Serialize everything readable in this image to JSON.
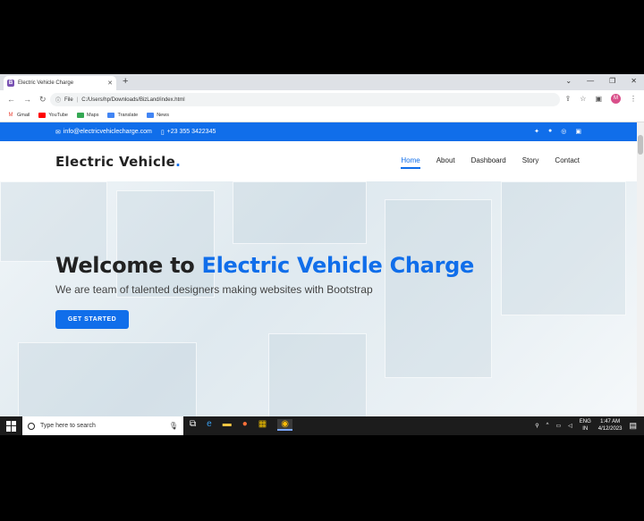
{
  "browser": {
    "tab_title": "Electric Vehicle Charge",
    "tab_favicon": "B",
    "url_prefix": "File",
    "url": "C:/Users/hp/Downloads/BizLand/index.html",
    "profile_initial": "M",
    "bookmarks": [
      {
        "label": "Gmail",
        "icon": "gmail-icon",
        "color": "#ea4335"
      },
      {
        "label": "YouTube",
        "icon": "youtube-icon",
        "color": "#ff0000"
      },
      {
        "label": "Maps",
        "icon": "maps-icon",
        "color": "#34a853"
      },
      {
        "label": "Translate",
        "icon": "translate-icon",
        "color": "#4285f4"
      },
      {
        "label": "News",
        "icon": "news-icon",
        "color": "#4285f4"
      }
    ]
  },
  "site": {
    "email": "info@electricvehiclecharge.com",
    "phone": "+23 355 3422345",
    "logo": "Electric Vehicle",
    "logo_dot": ".",
    "nav": [
      "Home",
      "About",
      "Dashboard",
      "Story",
      "Contact"
    ],
    "hero_title_plain": "Welcome to ",
    "hero_title_accent": "Electric Vehicle Charge",
    "hero_subtitle": "We are team of talented designers making websites with Bootstrap",
    "cta": "GET STARTED",
    "accent_color": "#106eea"
  },
  "taskbar": {
    "search_placeholder": "Type here to search",
    "lang_top": "ENG",
    "lang_bottom": "IN",
    "time": "1:47 AM",
    "date": "4/12/2023"
  }
}
